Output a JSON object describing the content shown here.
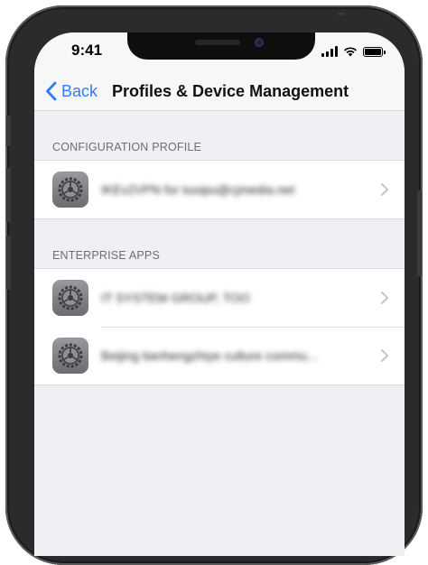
{
  "status_bar": {
    "time": "9:41",
    "icons": [
      "cellular-signal-icon",
      "wifi-icon",
      "battery-icon"
    ],
    "battery_level_percent": 100
  },
  "nav": {
    "back_label": "Back",
    "title": "Profiles & Device Management"
  },
  "sections": {
    "configuration": {
      "header": "CONFIGURATION PROFILE",
      "items": [
        {
          "label": "IKEv2VPN for tuoipu@cjmedia.net",
          "icon": "settings-icon"
        }
      ]
    },
    "enterprise": {
      "header": "ENTERPRISE APPS",
      "items": [
        {
          "label": "IT SYSTEM GROUP, TOO",
          "icon": "settings-icon"
        },
        {
          "label": "Beijing tianhengzhiye culture commu...",
          "icon": "settings-icon"
        }
      ]
    }
  },
  "colors": {
    "accent": "#2f7cf6",
    "background": "#efeff4",
    "section_header": "#6d6d72",
    "separator": "#dcdce0"
  }
}
